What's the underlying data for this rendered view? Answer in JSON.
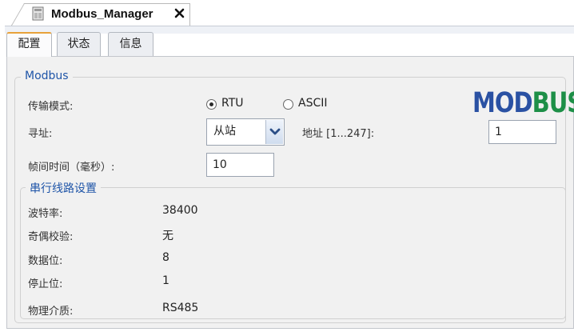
{
  "editor": {
    "title": "Modbus_Manager",
    "close_icon": "close-icon",
    "doc_icon": "document-icon"
  },
  "tabs": [
    {
      "label": "配置",
      "active": true
    },
    {
      "label": "状态",
      "active": false
    },
    {
      "label": "信息",
      "active": false
    }
  ],
  "modbus_group": {
    "legend": "Modbus",
    "logo_text": "MODBUS",
    "logo_colors": {
      "M": "#2a51a3",
      "O": "#2a51a3",
      "D": "#2a51a3",
      "B": "#1d8f47",
      "U": "#1d8f47",
      "S": "#1d8f47"
    },
    "transmission_mode": {
      "label": "传输模式:",
      "options": [
        {
          "label": "RTU",
          "selected": true
        },
        {
          "label": "ASCII",
          "selected": false
        }
      ]
    },
    "addressing": {
      "label": "寻址:",
      "selected": "从站",
      "address_label": "地址 [1...247]:",
      "address_value": "1"
    },
    "interframe": {
      "label": "帧间时间（毫秒）:",
      "value": "10"
    }
  },
  "serial_group": {
    "legend": "串行线路设置",
    "rows": [
      {
        "label": "波特率:",
        "value": "38400"
      },
      {
        "label": "奇偶校验:",
        "value": "无"
      },
      {
        "label": "数据位:",
        "value": "8"
      },
      {
        "label": "停止位:",
        "value": "1"
      },
      {
        "label": "物理介质:",
        "value": "RS485"
      }
    ]
  },
  "colors": {
    "legend": "#1f55a8",
    "active_tab_accent": "#e8a23a",
    "panel_bg": "#f1f1f1"
  }
}
